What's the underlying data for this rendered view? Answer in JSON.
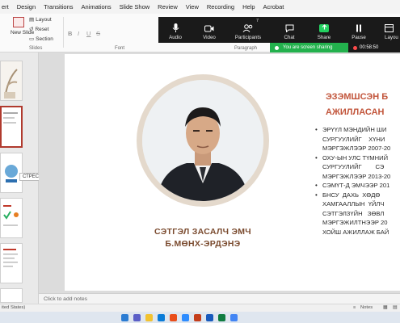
{
  "menu": [
    "ert",
    "Design",
    "Transitions",
    "Animations",
    "Slide Show",
    "Review",
    "View",
    "Recording",
    "Help",
    "Acrobat"
  ],
  "ribbon": {
    "new_slide": "New Slide",
    "layout": "Layout",
    "reset": "Reset",
    "section": "Section",
    "slides_group": "Slides",
    "font_group": "Font",
    "paragraph_group": "Paragraph"
  },
  "zoom": {
    "audio": "Audio",
    "video": "Video",
    "participants": "Participants",
    "participants_count": "7",
    "chat": "Chat",
    "share": "Share",
    "pause": "Pause",
    "layout": "Layou",
    "sharing_banner": "You are screen sharing",
    "timer": "00:58:50"
  },
  "thumbnails": {
    "tooltip": "СТРЕССДЭГ ҮҮ?"
  },
  "slide": {
    "name_line1": "СЭТГЭЛ ЗАСАЛЧ ЭМЧ",
    "name_line2": "Б.МӨНХ-ЭРДЭНЭ",
    "heading_line1": "ЭЗЭМШСЭН Б",
    "heading_line2": "АЖИЛЛАСАН",
    "bullets": [
      [
        "ЭРҮҮЛ МЭНДИЙН ШИ",
        "СУРГУУЛИЙГ    ХҮНИ",
        "МЭРГЭЖЛЭЭР 2007-20"
      ],
      [
        "ОХУ-ЫН УЛС ТҮМНИЙ",
        "СУРГУУЛИЙГ        СЭ",
        "МЭРГЭЖЛЭЭР 2013-20"
      ],
      [
        "СЭМҮТ-Д ЭМЧЭЭР 201"
      ],
      [
        "БНСУ  ДАХЬ  ХӨДӨ",
        "ХАМГААЛЛЫН  ҮЙЛЧ",
        "СЭТГЭЛЗҮЙН   ЗӨВЛ",
        "МЭРГЭЖИЛТНЭЭР 20",
        "ХОЙШ АЖИЛЛАЖ БАЙ"
      ]
    ]
  },
  "notes_placeholder": "Click to add notes",
  "status": {
    "left": "ited States)",
    "notes": "Notes"
  }
}
